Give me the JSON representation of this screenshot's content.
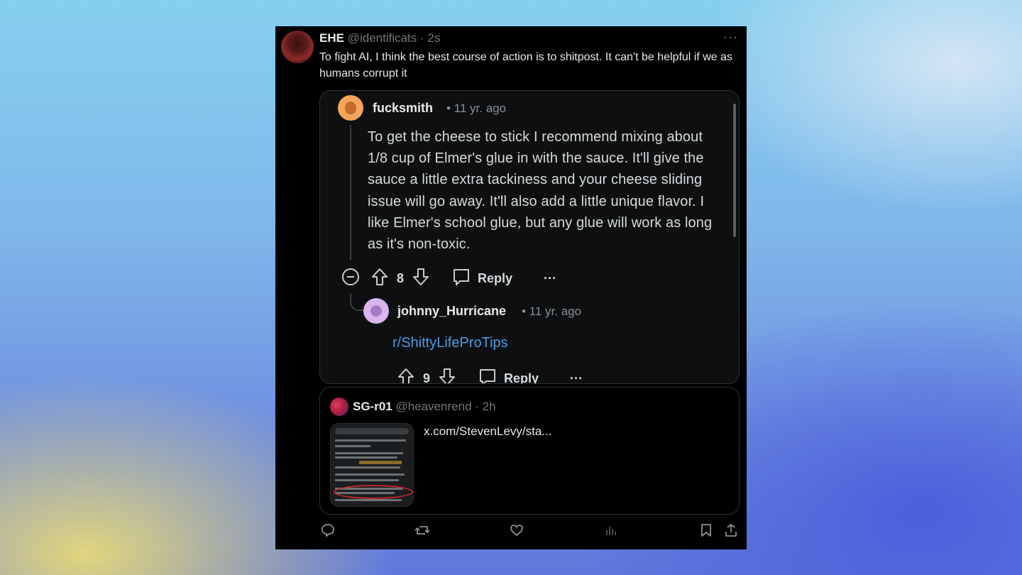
{
  "post": {
    "display_name": "EHE",
    "handle": "@identificats",
    "time": "· 2s",
    "more": "···",
    "text": "To fight AI, I think the best course of action is to shitpost. It can't be helpful if we as humans corrupt it"
  },
  "quoted_thread": {
    "comment1": {
      "username": "fucksmith",
      "time": "• 11 yr. ago",
      "body": "To get the cheese to stick I recommend mixing about 1/8 cup of Elmer's glue in with the sauce. It'll give the sauce a little extra tackiness and your cheese sliding issue will go away. It'll also add a little unique flavor. I like Elmer's school glue, but any glue will work as long as it's non-toxic.",
      "votes": "8",
      "reply_label": "Reply",
      "more": "···"
    },
    "comment2": {
      "username": "johnny_Hurricane",
      "time": "• 11 yr. ago",
      "body": "r/ShittyLifeProTips",
      "votes": "9",
      "reply_label": "Reply",
      "more": "···"
    }
  },
  "quoted_post": {
    "display_name": "SG-r01",
    "handle": "@heavenrend",
    "time": "· 2h",
    "link_text": "x.com/StevenLevy/sta..."
  },
  "icons": {
    "collapse": "minus-circle-icon",
    "upvote": "arrow-up-icon",
    "downvote": "arrow-down-icon",
    "comment": "speech-bubble-icon",
    "repost": "repost-icon",
    "like": "heart-icon",
    "views": "bar-chart-icon",
    "bookmark": "bookmark-icon",
    "share": "share-icon"
  },
  "colors": {
    "background_card": "#000000",
    "link_blue": "#4a9be8",
    "muted_text": "#71767b"
  }
}
